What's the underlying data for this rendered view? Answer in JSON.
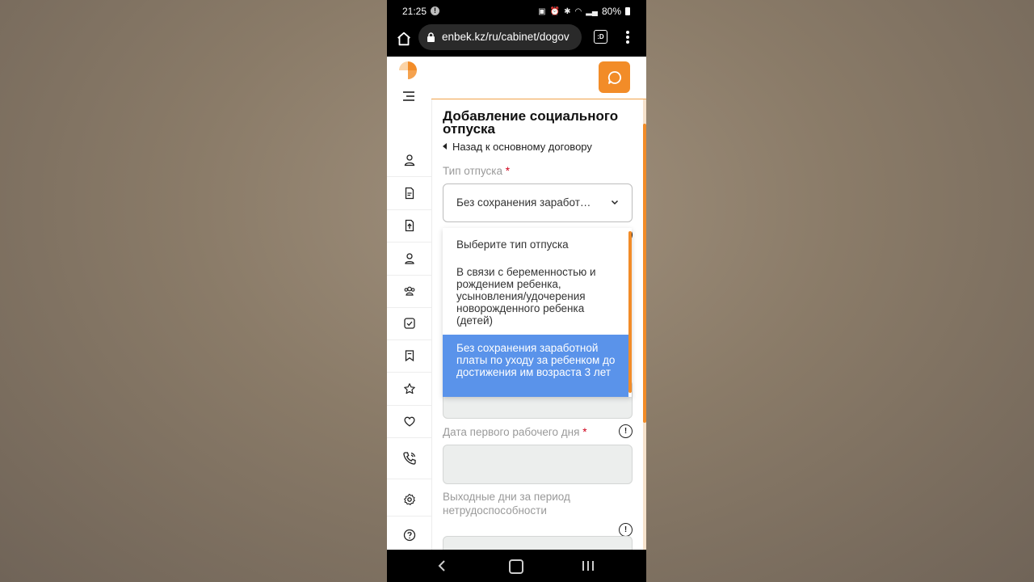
{
  "status_bar": {
    "time": "21:25",
    "battery": "80%"
  },
  "browser": {
    "url": "enbek.kz/ru/cabinet/dogov"
  },
  "page": {
    "title": "Добавление социального отпуска",
    "back_link": "Назад к основному договору",
    "leave_type": {
      "label": "Тип отпуска",
      "selected_value": "Без сохранения заработ…",
      "options": [
        "Выберите тип отпуска",
        "В связи с беременностью и рождением ребенка, усыновления/удочерения новорожденного ребенка (детей)",
        "Без сохранения заработной платы по уходу за ребенком до достижения им возраста 3 лет"
      ]
    },
    "first_work_day": {
      "label": "Дата первого рабочего дня"
    },
    "days_off": {
      "label": "Выходные дни за период нетрудоспособности"
    }
  },
  "colors": {
    "accent": "#f28c28",
    "selected_option": "#5a93ea",
    "required": "#d0021b"
  }
}
